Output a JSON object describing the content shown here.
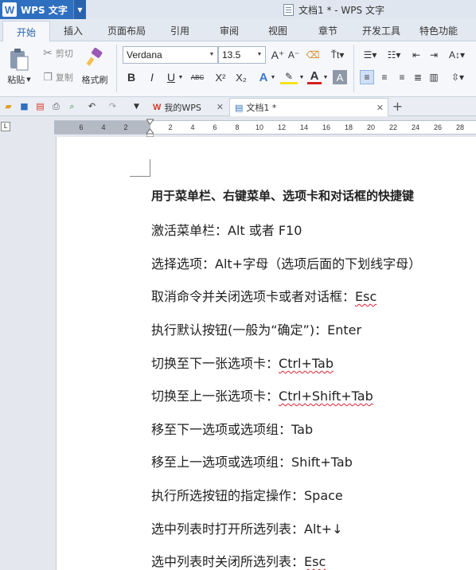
{
  "app": {
    "name": "WPS 文字",
    "document_title": "文档1 * - WPS 文字"
  },
  "menu_tabs": [
    "开始",
    "插入",
    "页面布局",
    "引用",
    "审阅",
    "视图",
    "章节",
    "开发工具",
    "特色功能"
  ],
  "ribbon": {
    "paste_label": "粘贴",
    "cut_label": "剪切",
    "copy_label": "复制",
    "format_painter_label": "格式刷",
    "font_name": "Verdana",
    "font_size": "13.5",
    "bold": "B",
    "italic": "I",
    "underline": "U",
    "strikethrough_label": "ABC",
    "superscript": "X²",
    "subscript": "X₂",
    "text_effect": "A",
    "font_color": "A",
    "highlight": "A"
  },
  "quick_access": {
    "tabs": [
      {
        "label": "我的WPS"
      },
      {
        "label": "文档1 *"
      }
    ]
  },
  "ruler": {
    "ticks": [
      "6",
      "4",
      "2",
      "2",
      "4",
      "6",
      "8",
      "10",
      "12",
      "14",
      "16",
      "18",
      "20",
      "22",
      "24",
      "26",
      "28"
    ]
  },
  "document": {
    "title": "用于菜单栏、右键菜单、选项卡和对话框的快捷键",
    "lines": [
      {
        "label": "激活菜单栏：",
        "keys": "Alt 或者 F10"
      },
      {
        "label": "选择选项：",
        "keys": "Alt+字母（选项后面的下划线字母）"
      },
      {
        "label": "取消命令并关闭选项卡或者对话框：",
        "keys": "Esc"
      },
      {
        "label": "执行默认按钮(一般为“确定”)：",
        "keys": "Enter"
      },
      {
        "label": "切换至下一张选项卡：",
        "keys": "Ctrl+Tab"
      },
      {
        "label": "切换至上一张选项卡：",
        "keys": "Ctrl+Shift+Tab"
      },
      {
        "label": "移至下一选项或选项组：",
        "keys": "Tab"
      },
      {
        "label": "移至上一选项或选项组：",
        "keys": "Shift+Tab"
      },
      {
        "label": "执行所选按钮的指定操作：",
        "keys": "Space"
      },
      {
        "label": "选中列表时打开所选列表：",
        "keys": "Alt+↓"
      },
      {
        "label": "选中列表时关闭所选列表：",
        "keys": "Esc"
      }
    ]
  },
  "colors": {
    "accent": "#2f6fc0",
    "spellcheck": "#dd2233"
  }
}
